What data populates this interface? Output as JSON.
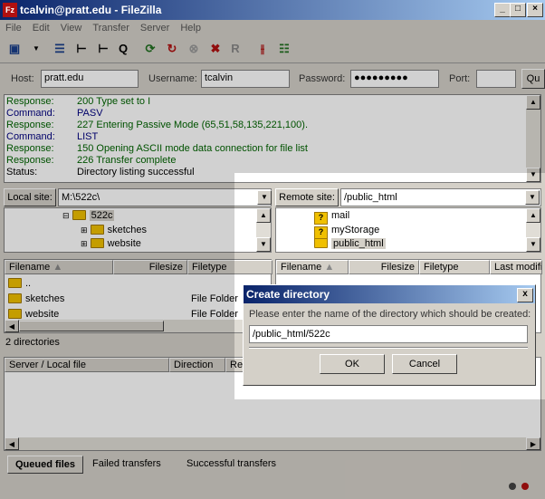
{
  "window": {
    "title": "tcalvin@pratt.edu - FileZilla"
  },
  "menu": [
    "File",
    "Edit",
    "View",
    "Transfer",
    "Server",
    "Help"
  ],
  "quickconnect": {
    "host_label": "Host:",
    "host_value": "pratt.edu",
    "user_label": "Username:",
    "user_value": "tcalvin",
    "pass_label": "Password:",
    "pass_value": "●●●●●●●●●",
    "port_label": "Port:",
    "port_value": "",
    "connect_label": "Qu"
  },
  "log": [
    {
      "k": "Response:",
      "v": "200 Type set to I"
    },
    {
      "k": "Command:",
      "v": "PASV"
    },
    {
      "k": "Response:",
      "v": "227 Entering Passive Mode (65,51,58,135,221,100)."
    },
    {
      "k": "Command:",
      "v": "LIST"
    },
    {
      "k": "Response:",
      "v": "150 Opening ASCII mode data connection for file list"
    },
    {
      "k": "Response:",
      "v": "226 Transfer complete"
    },
    {
      "k": "Status:",
      "v": "Directory listing successful"
    }
  ],
  "local": {
    "site_label": "Local site:",
    "path": "M:\\522c\\",
    "tree": [
      "522c",
      "sketches",
      "website"
    ],
    "headers": [
      "Filename",
      "Filesize",
      "Filetype"
    ],
    "files": [
      {
        "name": "..",
        "type": ""
      },
      {
        "name": "sketches",
        "type": "File Folder"
      },
      {
        "name": "website",
        "type": "File Folder"
      }
    ],
    "status": "2 directories"
  },
  "remote": {
    "site_label": "Remote site:",
    "path": "/public_html",
    "tree": [
      "mail",
      "myStorage",
      "public_html"
    ],
    "headers": [
      "Filename",
      "Filesize",
      "Filetype",
      "Last modifi"
    ]
  },
  "queue": {
    "headers": [
      "Server / Local file",
      "Direction",
      "Re"
    ]
  },
  "tabs": [
    "Queued files",
    "Failed transfers",
    "Successful transfers"
  ],
  "dialog": {
    "title": "Create directory",
    "prompt": "Please enter the name of the directory which should be created:",
    "value": "/public_html/522c",
    "ok": "OK",
    "cancel": "Cancel",
    "close": "x"
  }
}
